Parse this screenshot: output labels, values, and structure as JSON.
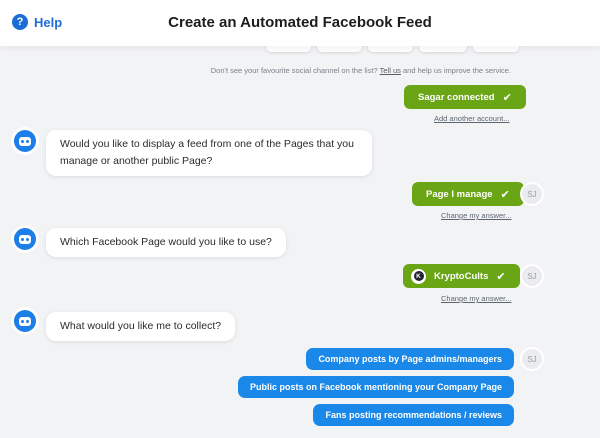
{
  "header": {
    "help_label": "Help",
    "help_icon": "?",
    "title": "Create an Automated Facebook Feed"
  },
  "note": {
    "before": "Don't see your favourite social channel on the list?",
    "link": "Tell us",
    "after": "and help us improve the service."
  },
  "account": {
    "connected_label": "Sagar connected",
    "add_another": "Add another account..."
  },
  "conversation": [
    {
      "bot": "Would you like to display a feed from one of the Pages that you manage or another public Page?",
      "reply": "Page I manage",
      "change": "Change my answer..."
    },
    {
      "bot": "Which Facebook Page would you like to use?",
      "reply": "KryptoCults",
      "change": "Change my answer..."
    },
    {
      "bot": "What would you like me to collect?"
    }
  ],
  "user_initials": "SJ",
  "page_icon_letter": "K",
  "options": [
    "Company posts by Page admins/managers",
    "Public posts on Facebook mentioning your Company Page",
    "Fans posting recommendations / reviews"
  ],
  "colors": {
    "accent_blue": "#1c6ed6",
    "reply_green": "#6aa516",
    "option_blue": "#1a88e8"
  }
}
